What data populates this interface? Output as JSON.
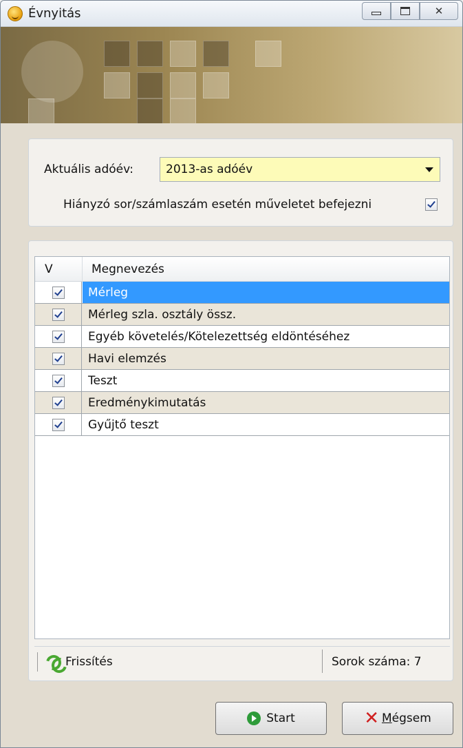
{
  "window": {
    "title": "Évnyitás"
  },
  "settings": {
    "year_label": "Aktuális adóév:",
    "year_value": "2013-as adóév",
    "missing_label": "Hiányzó sor/számlaszám esetén műveletet befejezni",
    "missing_checked": true
  },
  "grid": {
    "headers": {
      "v": "V",
      "name": "Megnevezés"
    },
    "rows": [
      {
        "name": "Mérleg",
        "checked": true,
        "selected": true
      },
      {
        "name": "Mérleg szla. osztály össz.",
        "checked": true
      },
      {
        "name": "Egyéb követelés/Kötelezettség eldöntéséhez",
        "checked": true
      },
      {
        "name": "Havi elemzés",
        "checked": true
      },
      {
        "name": "Teszt",
        "checked": true
      },
      {
        "name": "Eredménykimutatás",
        "checked": true
      },
      {
        "name": "Gyűjtő teszt",
        "checked": true
      }
    ]
  },
  "status": {
    "refresh_label": "Frissítés",
    "row_count": "Sorok száma: 7"
  },
  "buttons": {
    "start_label": "Start",
    "cancel_first": "M",
    "cancel_rest": "égsem"
  },
  "colors": {
    "selection": "#3399ff",
    "combo_bg": "#fdfbb8",
    "alt_row": "#eae5d9"
  }
}
